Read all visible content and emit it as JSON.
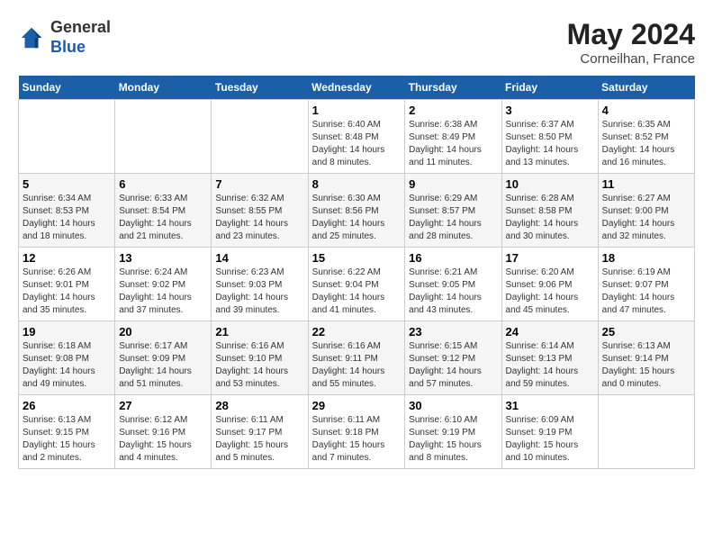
{
  "header": {
    "logo_line1": "General",
    "logo_line2": "Blue",
    "month_year": "May 2024",
    "location": "Corneilhan, France"
  },
  "days_of_week": [
    "Sunday",
    "Monday",
    "Tuesday",
    "Wednesday",
    "Thursday",
    "Friday",
    "Saturday"
  ],
  "weeks": [
    [
      {
        "num": "",
        "info": ""
      },
      {
        "num": "",
        "info": ""
      },
      {
        "num": "",
        "info": ""
      },
      {
        "num": "1",
        "info": "Sunrise: 6:40 AM\nSunset: 8:48 PM\nDaylight: 14 hours\nand 8 minutes."
      },
      {
        "num": "2",
        "info": "Sunrise: 6:38 AM\nSunset: 8:49 PM\nDaylight: 14 hours\nand 11 minutes."
      },
      {
        "num": "3",
        "info": "Sunrise: 6:37 AM\nSunset: 8:50 PM\nDaylight: 14 hours\nand 13 minutes."
      },
      {
        "num": "4",
        "info": "Sunrise: 6:35 AM\nSunset: 8:52 PM\nDaylight: 14 hours\nand 16 minutes."
      }
    ],
    [
      {
        "num": "5",
        "info": "Sunrise: 6:34 AM\nSunset: 8:53 PM\nDaylight: 14 hours\nand 18 minutes."
      },
      {
        "num": "6",
        "info": "Sunrise: 6:33 AM\nSunset: 8:54 PM\nDaylight: 14 hours\nand 21 minutes."
      },
      {
        "num": "7",
        "info": "Sunrise: 6:32 AM\nSunset: 8:55 PM\nDaylight: 14 hours\nand 23 minutes."
      },
      {
        "num": "8",
        "info": "Sunrise: 6:30 AM\nSunset: 8:56 PM\nDaylight: 14 hours\nand 25 minutes."
      },
      {
        "num": "9",
        "info": "Sunrise: 6:29 AM\nSunset: 8:57 PM\nDaylight: 14 hours\nand 28 minutes."
      },
      {
        "num": "10",
        "info": "Sunrise: 6:28 AM\nSunset: 8:58 PM\nDaylight: 14 hours\nand 30 minutes."
      },
      {
        "num": "11",
        "info": "Sunrise: 6:27 AM\nSunset: 9:00 PM\nDaylight: 14 hours\nand 32 minutes."
      }
    ],
    [
      {
        "num": "12",
        "info": "Sunrise: 6:26 AM\nSunset: 9:01 PM\nDaylight: 14 hours\nand 35 minutes."
      },
      {
        "num": "13",
        "info": "Sunrise: 6:24 AM\nSunset: 9:02 PM\nDaylight: 14 hours\nand 37 minutes."
      },
      {
        "num": "14",
        "info": "Sunrise: 6:23 AM\nSunset: 9:03 PM\nDaylight: 14 hours\nand 39 minutes."
      },
      {
        "num": "15",
        "info": "Sunrise: 6:22 AM\nSunset: 9:04 PM\nDaylight: 14 hours\nand 41 minutes."
      },
      {
        "num": "16",
        "info": "Sunrise: 6:21 AM\nSunset: 9:05 PM\nDaylight: 14 hours\nand 43 minutes."
      },
      {
        "num": "17",
        "info": "Sunrise: 6:20 AM\nSunset: 9:06 PM\nDaylight: 14 hours\nand 45 minutes."
      },
      {
        "num": "18",
        "info": "Sunrise: 6:19 AM\nSunset: 9:07 PM\nDaylight: 14 hours\nand 47 minutes."
      }
    ],
    [
      {
        "num": "19",
        "info": "Sunrise: 6:18 AM\nSunset: 9:08 PM\nDaylight: 14 hours\nand 49 minutes."
      },
      {
        "num": "20",
        "info": "Sunrise: 6:17 AM\nSunset: 9:09 PM\nDaylight: 14 hours\nand 51 minutes."
      },
      {
        "num": "21",
        "info": "Sunrise: 6:16 AM\nSunset: 9:10 PM\nDaylight: 14 hours\nand 53 minutes."
      },
      {
        "num": "22",
        "info": "Sunrise: 6:16 AM\nSunset: 9:11 PM\nDaylight: 14 hours\nand 55 minutes."
      },
      {
        "num": "23",
        "info": "Sunrise: 6:15 AM\nSunset: 9:12 PM\nDaylight: 14 hours\nand 57 minutes."
      },
      {
        "num": "24",
        "info": "Sunrise: 6:14 AM\nSunset: 9:13 PM\nDaylight: 14 hours\nand 59 minutes."
      },
      {
        "num": "25",
        "info": "Sunrise: 6:13 AM\nSunset: 9:14 PM\nDaylight: 15 hours\nand 0 minutes."
      }
    ],
    [
      {
        "num": "26",
        "info": "Sunrise: 6:13 AM\nSunset: 9:15 PM\nDaylight: 15 hours\nand 2 minutes."
      },
      {
        "num": "27",
        "info": "Sunrise: 6:12 AM\nSunset: 9:16 PM\nDaylight: 15 hours\nand 4 minutes."
      },
      {
        "num": "28",
        "info": "Sunrise: 6:11 AM\nSunset: 9:17 PM\nDaylight: 15 hours\nand 5 minutes."
      },
      {
        "num": "29",
        "info": "Sunrise: 6:11 AM\nSunset: 9:18 PM\nDaylight: 15 hours\nand 7 minutes."
      },
      {
        "num": "30",
        "info": "Sunrise: 6:10 AM\nSunset: 9:19 PM\nDaylight: 15 hours\nand 8 minutes."
      },
      {
        "num": "31",
        "info": "Sunrise: 6:09 AM\nSunset: 9:19 PM\nDaylight: 15 hours\nand 10 minutes."
      },
      {
        "num": "",
        "info": ""
      }
    ]
  ]
}
